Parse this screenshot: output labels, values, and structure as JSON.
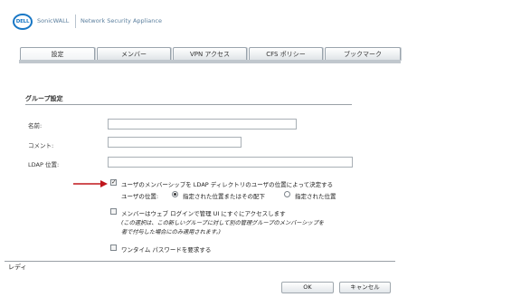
{
  "header": {
    "logo_text": "DELL",
    "brand": "SonicWALL",
    "product": "Network Security Appliance"
  },
  "tabs": [
    {
      "label": "設定",
      "active": true
    },
    {
      "label": "メンバー",
      "active": false
    },
    {
      "label": "VPN アクセス",
      "active": false
    },
    {
      "label": "CFS ポリシー",
      "active": false
    },
    {
      "label": "ブックマーク",
      "active": false
    }
  ],
  "group": {
    "title": "グループ設定",
    "name_label": "名前:",
    "name_value": "",
    "comment_label": "コメント:",
    "comment_value": "",
    "ldap_label": "LDAP 位置:",
    "ldap_value": ""
  },
  "options": {
    "ldap_membership": {
      "checked": true,
      "label": "ユーザのメンバーシップを LDAP ディレクトリのユーザの位置によって決定する"
    },
    "user_location": {
      "label": "ユーザの位置:",
      "radio1_label": "指定された位置またはその配下",
      "radio1_selected": true,
      "radio2_label": "指定された位置",
      "radio2_selected": false
    },
    "web_admin": {
      "checked": false,
      "label": "メンバーはウェブ ログインで管理 UI にすぐにアクセスします",
      "note_line1": "(この選択は、この新しいグループに対して別の管理グループのメンバーシップを",
      "note_line2": "者で付与した場合にのみ適用されます。)"
    },
    "otp": {
      "checked": false,
      "label": "ワンタイム パスワードを要求する"
    }
  },
  "status": {
    "text": "レディ"
  },
  "buttons": {
    "ok": "OK",
    "cancel": "キャンセル"
  },
  "colors": {
    "arrow": "#c0161c",
    "logo": "#1877c5"
  }
}
